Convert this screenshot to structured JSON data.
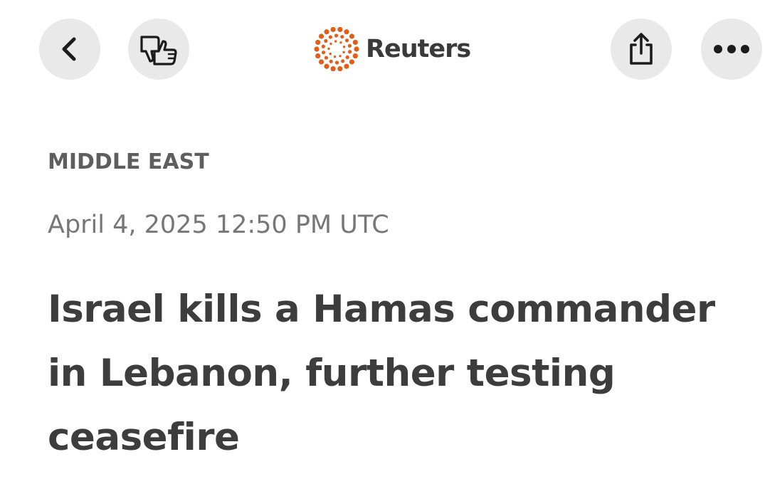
{
  "nav": {
    "back_icon": "chevron-left-icon",
    "feedback_icon": "thumbs-down-up-icon",
    "share_icon": "share-icon",
    "more_icon": "ellipsis-icon"
  },
  "brand": {
    "name": "Reuters",
    "logo_color": "#e35d16",
    "logo_icon": "reuters-dot-ring-logo"
  },
  "article": {
    "section": "MIDDLE EAST",
    "timestamp": "April 4, 2025 12:50 PM UTC",
    "headline": "Israel kills a Hamas commander in Lebanon, further testing ceasefire"
  },
  "colors": {
    "button_bg": "#e9e9e9",
    "text_dark": "#3d3d3d",
    "text_muted": "#777777",
    "section": "#5e5e5e"
  }
}
